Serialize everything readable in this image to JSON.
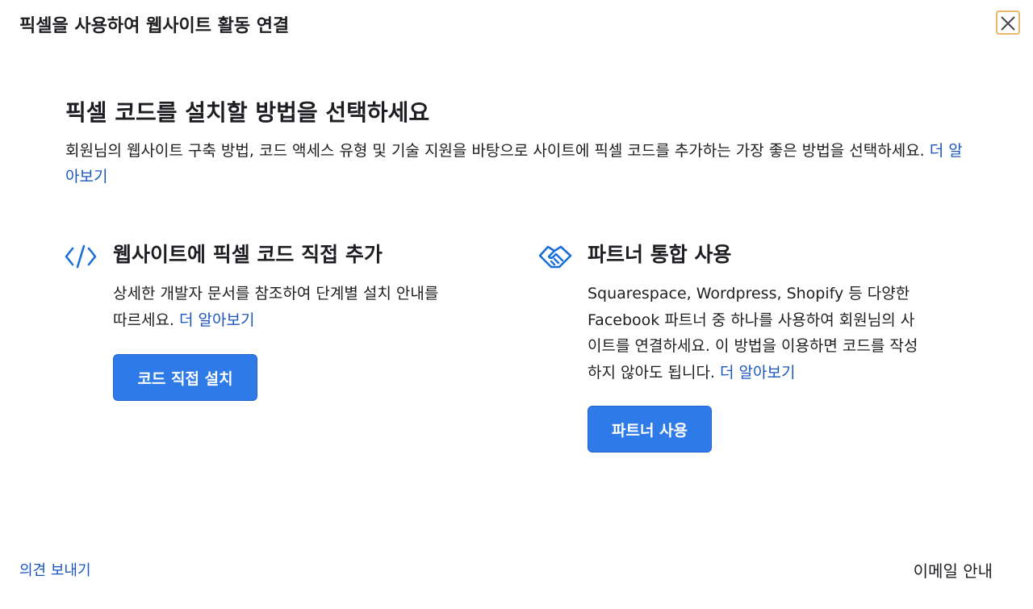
{
  "dialog": {
    "title": "픽셀을 사용하여 웹사이트 활동 연결",
    "close_icon": "close-icon"
  },
  "main": {
    "heading": "픽셀 코드를 설치할 방법을 선택하세요",
    "description": "회원님의 웹사이트 구축 방법, 코드 액세스 유형 및 기술 지원을 바탕으로 사이트에 픽셀 코드를 추가하는 가장 좋은 방법을 선택하세요.",
    "learn_more": "더 알아보기"
  },
  "options": {
    "manual": {
      "icon": "code-icon",
      "title": "웹사이트에 픽셀 코드 직접 추가",
      "description": "상세한 개발자 문서를 참조하여 단계별 설치 안내를 따르세요.",
      "learn_more": "더 알아보기",
      "button_label": "코드 직접 설치"
    },
    "partner": {
      "icon": "handshake-icon",
      "title": "파트너 통합 사용",
      "description": "Squarespace, Wordpress, Shopify 등 다양한 Facebook 파트너 중 하나를 사용하여 회원님의 사이트를 연결하세요. 이 방법을 이용하면 코드를 작성하지 않아도 됩니다.",
      "learn_more": "더 알아보기",
      "button_label": "파트너 사용"
    }
  },
  "footer": {
    "feedback_link": "의견 보내기",
    "email_guide": "이메일 안내"
  },
  "colors": {
    "accent": "#2d7ae8",
    "link": "#1a56c2",
    "text": "#1c1e21",
    "close_focus_ring": "#e8b86d"
  }
}
